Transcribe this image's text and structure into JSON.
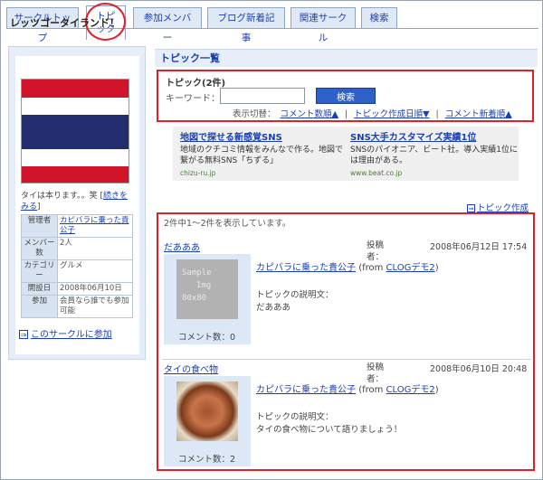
{
  "tabs": [
    {
      "label": "サークルトップ"
    },
    {
      "label": "トピック"
    },
    {
      "label": "参加メンバー"
    },
    {
      "label": "ブログ新着記事"
    },
    {
      "label": "関連サークル"
    },
    {
      "label": "検索"
    }
  ],
  "sidebar": {
    "title": "レッツゴータイランド！",
    "description": "タイは本ります。。笑",
    "more_link": "続きをみる",
    "info": [
      {
        "key": "管理者",
        "value": "カピバラに乗った貴公子",
        "link": true
      },
      {
        "key": "メンバー数",
        "value": "2人",
        "link": false
      },
      {
        "key": "カテゴリー",
        "value": "グルメ",
        "link": false
      },
      {
        "key": "開設日",
        "value": "2008年06月10日",
        "link": false
      },
      {
        "key": "参加",
        "value": "会員なら誰でも参加可能",
        "link": false
      }
    ],
    "join_link": "このサークルに参加"
  },
  "main": {
    "heading": "トピック一覧",
    "search": {
      "title": "トピック(2件)",
      "keyword_label": "キーワード：",
      "keyword_value": "",
      "button": "検索",
      "sort_label": "表示切替：",
      "sort_options": [
        "コメント数順▲",
        "トピック作成日順▼",
        "コメント新着順▲"
      ],
      "separator": "|"
    },
    "ads": [
      {
        "title": "地図で探せる新感覚SNS",
        "text": "地域のクチコミ情報をみんなで作る。地図で繋がる無料SNS「ちずる」",
        "url": "chizu-ru.jp"
      },
      {
        "title": "SNS大手カスタマイズ実績1位",
        "text": "SNSのパイオニア、ビート社。導入実績1位には理由がある。",
        "url": "www.beat.co.jp"
      }
    ],
    "create_link": "トピック作成",
    "count_text": "2件中1～2件を表示しています。",
    "topics": [
      {
        "title": "だあああ",
        "thumb": "sample",
        "thumb_text": [
          "Sample",
          "Img",
          "80x80"
        ],
        "comments": "コメント数：0",
        "author": "カピバラに乗った貴公子",
        "from_prefix": "(from ",
        "from_link": "CLOGデモ2",
        "from_suffix": ")",
        "desc_label": "トピックの説明文：",
        "desc": "だあああ",
        "poster_label": "投稿者：",
        "date": "2008年06月12日 17:54"
      },
      {
        "title": "タイの食べ物",
        "thumb": "food",
        "thumb_text": [
          "",
          "",
          ""
        ],
        "comments": "コメント数：2",
        "author": "カピバラに乗った貴公子",
        "from_prefix": "(from ",
        "from_link": "CLOGデモ2",
        "from_suffix": ")",
        "desc_label": "トピックの説明文：",
        "desc": "タイの食べ物について語りましょう！",
        "poster_label": "投稿者：",
        "date": "2008年06月10日 20:48"
      }
    ]
  }
}
